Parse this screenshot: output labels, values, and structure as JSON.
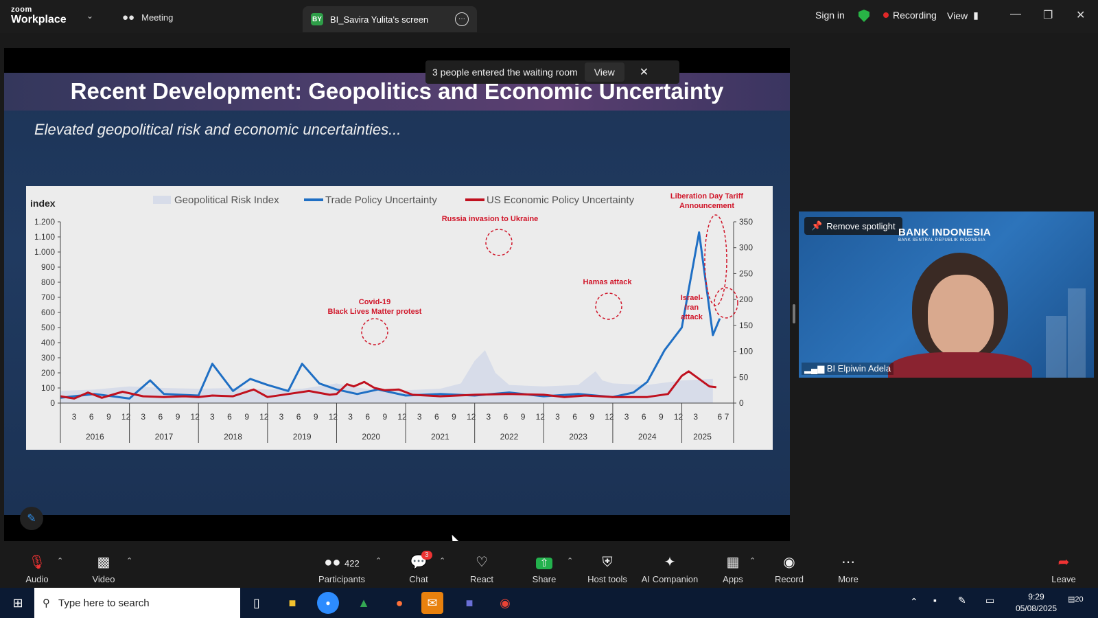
{
  "app": {
    "logo_top": "zoom",
    "logo_bottom": "Workplace",
    "meeting_tab": "Meeting",
    "screen_badge": "BY",
    "screen_tab": "BI_Savira Yulita's screen",
    "sign_in": "Sign in",
    "recording": "Recording",
    "view": "View"
  },
  "notification": {
    "text": "3 people entered the waiting room",
    "view_label": "View"
  },
  "slide": {
    "title": "Recent Development: Geopolitics and Economic Uncertainty",
    "subtitle": "Elevated geopolitical risk and economic uncertainties..."
  },
  "chart_data": {
    "type": "area",
    "ylabel": "index",
    "left_ylim": [
      0,
      1200
    ],
    "left_ticks": [
      "0",
      "100",
      "200",
      "300",
      "400",
      "500",
      "600",
      "700",
      "800",
      "900",
      "1.000",
      "1.100",
      "1.200"
    ],
    "right_ylim": [
      0,
      350
    ],
    "right_ticks": [
      "0",
      "50",
      "100",
      "150",
      "200",
      "250",
      "300",
      "350"
    ],
    "years": [
      "2016",
      "2017",
      "2018",
      "2019",
      "2020",
      "2021",
      "2022",
      "2023",
      "2024",
      "2025"
    ],
    "month_ticks": [
      "3",
      "6",
      "9",
      "12"
    ],
    "last_year_month_ticks": [
      "3",
      "6",
      "7"
    ],
    "legend": [
      "Geopolitical Risk Index",
      "Trade Policy Uncertainty",
      "US Economic Policy Uncertainty"
    ],
    "colors": {
      "gpr": "#d7dce9",
      "tpu": "#1f6fc4",
      "epu": "#c0111f"
    },
    "gpr_x": [
      2016.0,
      2016.5,
      2017.0,
      2017.5,
      2018.0,
      2018.5,
      2019.0,
      2019.5,
      2020.0,
      2020.2,
      2020.5,
      2021.0,
      2021.5,
      2021.8,
      2022.0,
      2022.15,
      2022.3,
      2022.5,
      2023.0,
      2023.5,
      2023.75,
      2023.85,
      2024.0,
      2024.5,
      2025.0,
      2025.45
    ],
    "gpr_values": [
      80,
      90,
      110,
      100,
      95,
      100,
      90,
      95,
      130,
      110,
      90,
      85,
      95,
      130,
      280,
      350,
      200,
      120,
      110,
      120,
      210,
      150,
      130,
      120,
      150,
      160
    ],
    "tpu_x": [
      2016.0,
      2016.5,
      2017.0,
      2017.3,
      2017.5,
      2018.0,
      2018.2,
      2018.5,
      2018.75,
      2019.0,
      2019.3,
      2019.5,
      2019.75,
      2020.0,
      2020.3,
      2020.6,
      2021.0,
      2021.5,
      2022.0,
      2022.5,
      2023.0,
      2023.5,
      2024.0,
      2024.3,
      2024.5,
      2024.75,
      2025.0,
      2025.25,
      2025.45,
      2025.55
    ],
    "tpu_values": [
      35,
      60,
      30,
      150,
      60,
      50,
      260,
      80,
      160,
      120,
      80,
      260,
      130,
      90,
      60,
      90,
      50,
      60,
      50,
      70,
      45,
      60,
      40,
      70,
      140,
      350,
      500,
      1130,
      450,
      560
    ],
    "epu_x": [
      2016.0,
      2016.2,
      2016.4,
      2016.6,
      2016.9,
      2017.2,
      2017.5,
      2017.8,
      2018.0,
      2018.2,
      2018.5,
      2018.8,
      2019.0,
      2019.3,
      2019.6,
      2019.9,
      2020.0,
      2020.15,
      2020.25,
      2020.4,
      2020.55,
      2020.7,
      2020.9,
      2021.1,
      2021.5,
      2022.0,
      2022.5,
      2023.0,
      2023.3,
      2023.6,
      2024.0,
      2024.5,
      2024.8,
      2025.0,
      2025.1,
      2025.25,
      2025.4,
      2025.5
    ],
    "epu_values": [
      45,
      30,
      70,
      35,
      75,
      45,
      40,
      45,
      40,
      50,
      45,
      90,
      40,
      60,
      80,
      55,
      60,
      125,
      110,
      140,
      100,
      85,
      90,
      55,
      45,
      55,
      60,
      55,
      40,
      50,
      40,
      40,
      60,
      180,
      210,
      160,
      110,
      105
    ],
    "annotations": [
      {
        "label": "Covid-19",
        "label2": "Black Lives Matter protest"
      },
      {
        "label": "Russia invasion to Ukraine"
      },
      {
        "label": "Hamas attack"
      },
      {
        "label": "Israel-",
        "label2": "Iran",
        "label3": "attack"
      },
      {
        "label": "Liberation Day Tariff",
        "label2": "Announcement"
      }
    ]
  },
  "video": {
    "spotlight": "Remove spotlight",
    "org": "BANK INDONESIA",
    "org_sub": "BANK SENTRAL REPUBLIK INDONESIA",
    "name": "BI Elpiwin Adela"
  },
  "toolbar": {
    "audio": "Audio",
    "video": "Video",
    "participants": "Participants",
    "participants_count": "422",
    "chat": "Chat",
    "chat_badge": "3",
    "react": "React",
    "share": "Share",
    "host_tools": "Host tools",
    "ai_companion": "AI Companion",
    "apps": "Apps",
    "record": "Record",
    "more": "More",
    "leave": "Leave"
  },
  "taskbar": {
    "search_placeholder": "Type here to search",
    "time": "9:29",
    "date": "05/08/2025",
    "notif_count": "20"
  }
}
